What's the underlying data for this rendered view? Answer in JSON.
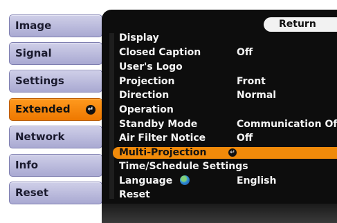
{
  "tabs": [
    {
      "label": "Image",
      "active": false
    },
    {
      "label": "Signal",
      "active": false
    },
    {
      "label": "Settings",
      "active": false
    },
    {
      "label": "Extended",
      "active": true
    },
    {
      "label": "Network",
      "active": false
    },
    {
      "label": "Info",
      "active": false
    },
    {
      "label": "Reset",
      "active": false
    }
  ],
  "return_label": "Return",
  "menu": [
    {
      "label": "Display",
      "value": ""
    },
    {
      "label": "Closed Caption",
      "value": "Off"
    },
    {
      "label": "User's Logo",
      "value": ""
    },
    {
      "label": "Projection",
      "value": "Front"
    },
    {
      "label": "Direction",
      "value": "Normal"
    },
    {
      "label": "Operation",
      "value": ""
    },
    {
      "label": "Standby Mode",
      "value": "Communication Off"
    },
    {
      "label": "Air Filter Notice",
      "value": "Off"
    },
    {
      "label": "Multi-Projection",
      "value": "",
      "selected": true
    },
    {
      "label": "Time/Schedule Settings",
      "value": ""
    },
    {
      "label": "Language",
      "value": "English"
    },
    {
      "label": "Reset",
      "value": ""
    }
  ],
  "colors": {
    "tab": "#b9b9dc",
    "tab_active": "#f08a0a",
    "panel": "#0d0d0d",
    "selected_row": "#f08a0a"
  },
  "icons": {
    "enter": "enter-icon",
    "language": "globe-icon"
  }
}
